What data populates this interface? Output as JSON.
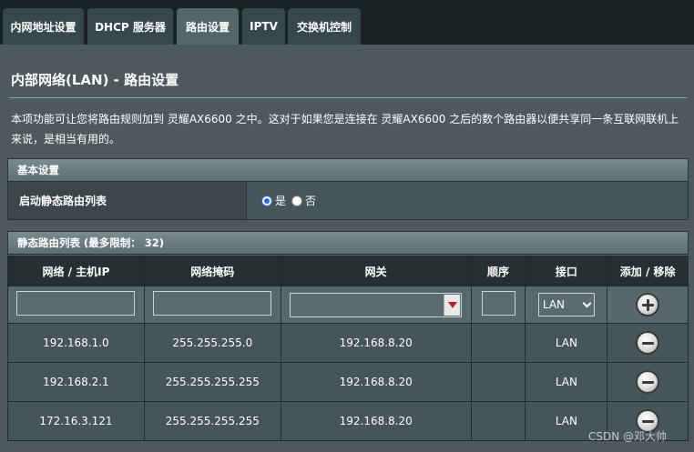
{
  "tabs": [
    {
      "label": "内网地址设置",
      "active": false
    },
    {
      "label": "DHCP 服务器",
      "active": false
    },
    {
      "label": "路由设置",
      "active": true
    },
    {
      "label": "IPTV",
      "active": false
    },
    {
      "label": "交换机控制",
      "active": false
    }
  ],
  "page": {
    "title": "内部网络(LAN) - 路由设置",
    "description": "本项功能可让您将路由规则加到 灵耀AX6600 之中。这对于如果您是连接在 灵耀AX6600 之后的数个路由器以便共享同一条互联网联机上来说，是相当有用的。"
  },
  "basic": {
    "section_title": "基本设置",
    "static_route_label": "启动静态路由列表",
    "options": [
      {
        "label": "是",
        "checked": true
      },
      {
        "label": "否",
        "checked": false
      }
    ]
  },
  "routes": {
    "section_title": "静态路由列表 (最多限制： 32)",
    "headers": [
      "网络 / 主机IP",
      "网络掩码",
      "网关",
      "顺序",
      "接口",
      "添加 / 移除"
    ],
    "input_row": {
      "network": "",
      "netmask": "",
      "gateway": "",
      "order": "",
      "interface": "LAN"
    },
    "rows": [
      {
        "network": "192.168.1.0",
        "netmask": "255.255.255.0",
        "gateway": "192.168.8.20",
        "order": "",
        "interface": "LAN"
      },
      {
        "network": "192.168.2.1",
        "netmask": "255.255.255.255",
        "gateway": "192.168.8.20",
        "order": "",
        "interface": "LAN"
      },
      {
        "network": "172.16.3.121",
        "netmask": "255.255.255.255",
        "gateway": "192.168.8.20",
        "order": "",
        "interface": "LAN"
      }
    ]
  },
  "watermark": "CSDN @邓大帅",
  "colors": {
    "background": "#4d595d",
    "tabbar": "#1a2224",
    "active_tab": "#55666b",
    "radio_accent": "#2a6fd6",
    "dropdown_arrow": "#b3242a"
  },
  "icons": {
    "add": "plus-circle-icon",
    "remove": "minus-circle-icon",
    "dropdown": "triangle-down-icon"
  }
}
